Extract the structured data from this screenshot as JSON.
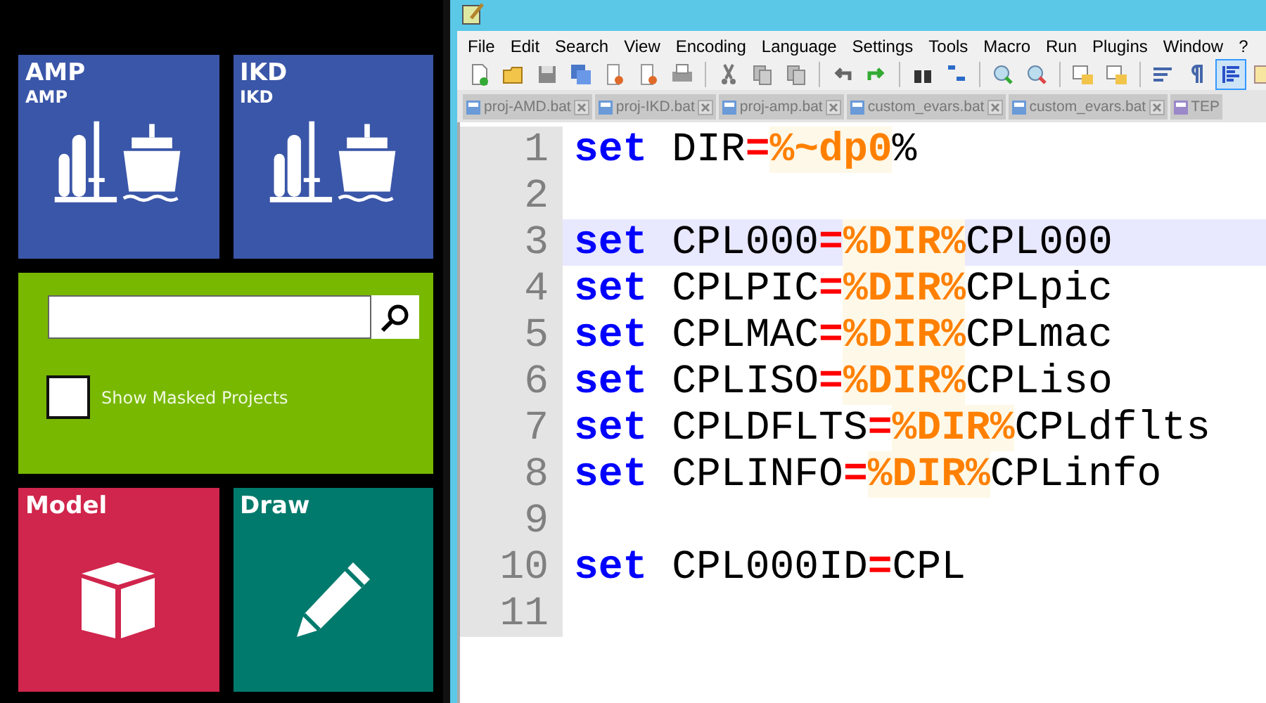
{
  "launcher": {
    "project_tiles": [
      {
        "title": "AMP",
        "subtitle": "AMP",
        "color": "#3a56a8",
        "kind": "plant-ship"
      },
      {
        "title": "IKD",
        "subtitle": "IKD",
        "color": "#3a56a8",
        "kind": "plant-ship"
      }
    ],
    "search": {
      "checkbox_label": "Show Masked Projects",
      "checked": false
    },
    "action_tiles": [
      {
        "title": "Model",
        "color": "#d0254c",
        "kind": "cube"
      },
      {
        "title": "Draw",
        "color": "#007a6c",
        "kind": "pencil"
      }
    ]
  },
  "editor": {
    "menu": [
      "File",
      "Edit",
      "Search",
      "View",
      "Encoding",
      "Language",
      "Settings",
      "Tools",
      "Macro",
      "Run",
      "Plugins",
      "Window",
      "?"
    ],
    "tabs": [
      {
        "label": "proj-AMD.bat",
        "selected": false
      },
      {
        "label": "proj-IKD.bat",
        "selected": false
      },
      {
        "label": "proj-amp.bat",
        "selected": false
      },
      {
        "label": "custom_evars.bat",
        "selected": false
      },
      {
        "label": "custom_evars.bat",
        "selected": false
      },
      {
        "label": "TEP",
        "selected": false
      }
    ],
    "lines": [
      {
        "number": "1",
        "current": false,
        "tokens": [
          {
            "kind": "keyword",
            "text": "set"
          },
          {
            "kind": "plain",
            "text": " DIR"
          },
          {
            "kind": "op",
            "text": "="
          },
          {
            "kind": "var",
            "text": "%~dp0"
          },
          {
            "kind": "plain",
            "text": "%"
          }
        ]
      },
      {
        "number": "2",
        "current": false
      },
      {
        "number": "3",
        "current": true,
        "tokens": [
          {
            "kind": "keyword",
            "text": "set"
          },
          {
            "kind": "plain",
            "text": " CPL000"
          },
          {
            "kind": "op",
            "text": "="
          },
          {
            "kind": "var",
            "text": "%DIR%"
          },
          {
            "kind": "plain",
            "text": "CPL000"
          }
        ]
      },
      {
        "number": "4",
        "current": false,
        "tokens": [
          {
            "kind": "keyword",
            "text": "set"
          },
          {
            "kind": "plain",
            "text": " CPLPIC"
          },
          {
            "kind": "op",
            "text": "="
          },
          {
            "kind": "var",
            "text": "%DIR%"
          },
          {
            "kind": "plain",
            "text": "CPLpic"
          }
        ]
      },
      {
        "number": "5",
        "current": false,
        "tokens": [
          {
            "kind": "keyword",
            "text": "set"
          },
          {
            "kind": "plain",
            "text": " CPLMAC"
          },
          {
            "kind": "op",
            "text": "="
          },
          {
            "kind": "var",
            "text": "%DIR%"
          },
          {
            "kind": "plain",
            "text": "CPLmac"
          }
        ]
      },
      {
        "number": "6",
        "current": false,
        "tokens": [
          {
            "kind": "keyword",
            "text": "set"
          },
          {
            "kind": "plain",
            "text": " CPLISO"
          },
          {
            "kind": "op",
            "text": "="
          },
          {
            "kind": "var",
            "text": "%DIR%"
          },
          {
            "kind": "plain",
            "text": "CPLiso"
          }
        ]
      },
      {
        "number": "7",
        "current": false,
        "tokens": [
          {
            "kind": "keyword",
            "text": "set"
          },
          {
            "kind": "plain",
            "text": " CPLDFLTS"
          },
          {
            "kind": "op",
            "text": "="
          },
          {
            "kind": "var",
            "text": "%DIR%"
          },
          {
            "kind": "plain",
            "text": "CPLdflts"
          }
        ]
      },
      {
        "number": "8",
        "current": false,
        "tokens": [
          {
            "kind": "keyword",
            "text": "set"
          },
          {
            "kind": "plain",
            "text": " CPLINFO"
          },
          {
            "kind": "op",
            "text": "="
          },
          {
            "kind": "var",
            "text": "%DIR%"
          },
          {
            "kind": "plain",
            "text": "CPLinfo"
          }
        ]
      },
      {
        "number": "9",
        "current": false
      },
      {
        "number": "10",
        "current": false,
        "tokens": [
          {
            "kind": "keyword",
            "text": "set"
          },
          {
            "kind": "plain",
            "text": " CPL000ID"
          },
          {
            "kind": "op",
            "text": "="
          },
          {
            "kind": "plain",
            "text": "CPL"
          }
        ]
      },
      {
        "number": "11",
        "current": false
      }
    ]
  }
}
